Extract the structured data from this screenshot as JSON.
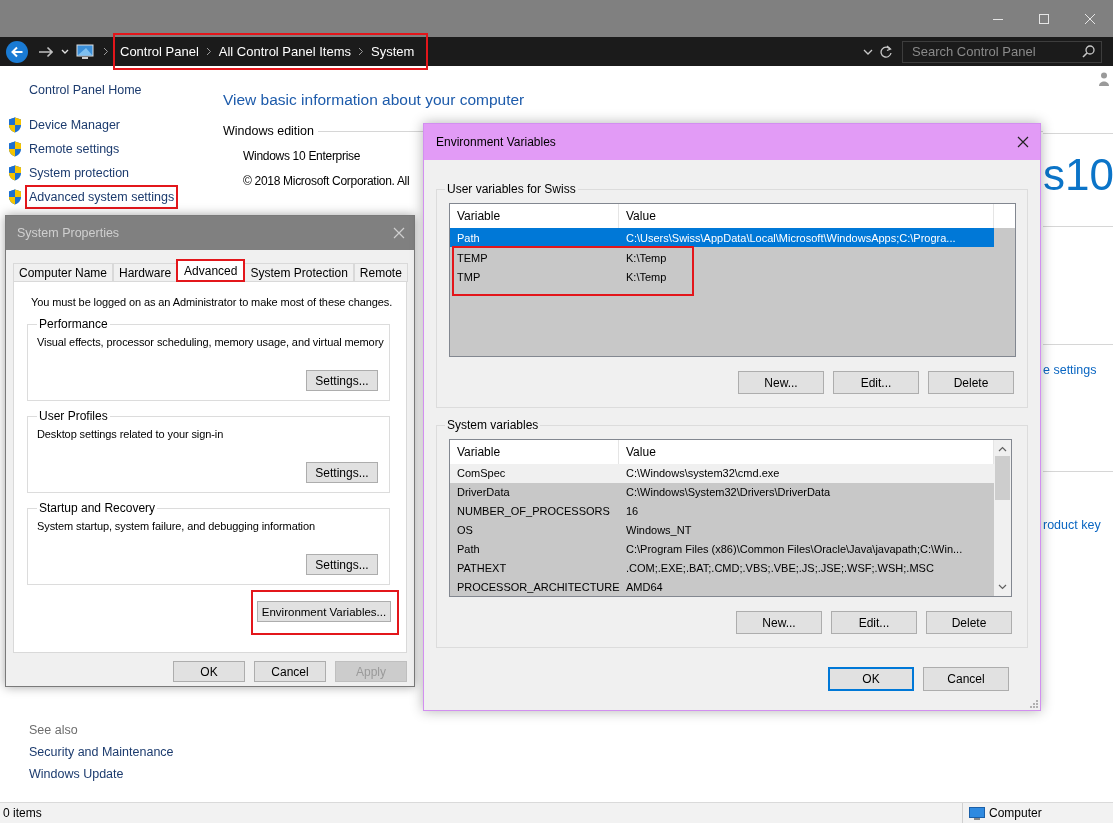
{
  "explorer": {
    "address_bar": {
      "breadcrumbs": [
        "Control Panel",
        "All Control Panel Items",
        "System"
      ],
      "highlighted": true
    },
    "search": {
      "placeholder": "Search Control Panel"
    },
    "sidebar": {
      "home": "Control Panel Home",
      "items": [
        {
          "label": "Device Manager",
          "highlighted": false
        },
        {
          "label": "Remote settings",
          "highlighted": false
        },
        {
          "label": "System protection",
          "highlighted": false
        },
        {
          "label": "Advanced system settings",
          "highlighted": true
        }
      ],
      "see_also": "See also",
      "links": [
        "Security and Maintenance",
        "Windows Update"
      ]
    },
    "main": {
      "heading": "View basic information about your computer",
      "section": "Windows edition",
      "lines": [
        "Windows 10 Enterprise",
        "© 2018 Microsoft Corporation. All"
      ],
      "logo_text": "s10",
      "links": [
        "e settings",
        "roduct key"
      ]
    },
    "status_bar": {
      "items": "0 items",
      "location": "Computer"
    }
  },
  "system_properties": {
    "title": "System Properties",
    "tabs": [
      {
        "label": "Computer Name",
        "selected": false,
        "highlighted": false
      },
      {
        "label": "Hardware",
        "selected": false,
        "highlighted": false
      },
      {
        "label": "Advanced",
        "selected": true,
        "highlighted": true
      },
      {
        "label": "System Protection",
        "selected": false,
        "highlighted": false
      },
      {
        "label": "Remote",
        "selected": false,
        "highlighted": false
      }
    ],
    "notice": "You must be logged on as an Administrator to make most of these changes.",
    "groups": [
      {
        "title": "Performance",
        "description": "Visual effects, processor scheduling, memory usage, and virtual memory",
        "button": "Settings..."
      },
      {
        "title": "User Profiles",
        "description": "Desktop settings related to your sign-in",
        "button": "Settings..."
      },
      {
        "title": "Startup and Recovery",
        "description": "System startup, system failure, and debugging information",
        "button": "Settings..."
      }
    ],
    "env_button": {
      "label": "Environment Variables...",
      "highlighted": true
    },
    "buttons": [
      {
        "label": "OK",
        "disabled": false
      },
      {
        "label": "Cancel",
        "disabled": false
      },
      {
        "label": "Apply",
        "disabled": true
      }
    ]
  },
  "environment_variables": {
    "title": "Environment Variables",
    "user": {
      "title": "User variables for Swiss",
      "columns": [
        "Variable",
        "Value"
      ],
      "focused": true,
      "rows": [
        {
          "variable": "Path",
          "value": "C:\\Users\\Swiss\\AppData\\Local\\Microsoft\\WindowsApps;C:\\Progra...",
          "selected": true,
          "highlighted": false
        },
        {
          "variable": "TEMP",
          "value": "K:\\Temp",
          "selected": false,
          "highlighted": true
        },
        {
          "variable": "TMP",
          "value": "K:\\Temp",
          "selected": false,
          "highlighted": true
        }
      ],
      "buttons": [
        "New...",
        "Edit...",
        "Delete"
      ]
    },
    "system": {
      "title": "System variables",
      "columns": [
        "Variable",
        "Value"
      ],
      "focused": false,
      "rows": [
        {
          "variable": "ComSpec",
          "value": "C:\\Windows\\system32\\cmd.exe",
          "selected": true,
          "highlighted": false
        },
        {
          "variable": "DriverData",
          "value": "C:\\Windows\\System32\\Drivers\\DriverData",
          "selected": false,
          "highlighted": false
        },
        {
          "variable": "NUMBER_OF_PROCESSORS",
          "value": "16",
          "selected": false,
          "highlighted": false
        },
        {
          "variable": "OS",
          "value": "Windows_NT",
          "selected": false,
          "highlighted": false
        },
        {
          "variable": "Path",
          "value": "C:\\Program Files (x86)\\Common Files\\Oracle\\Java\\javapath;C:\\Win...",
          "selected": false,
          "highlighted": false
        },
        {
          "variable": "PATHEXT",
          "value": ".COM;.EXE;.BAT;.CMD;.VBS;.VBE;.JS;.JSE;.WSF;.WSH;.MSC",
          "selected": false,
          "highlighted": false
        },
        {
          "variable": "PROCESSOR_ARCHITECTURE",
          "value": "AMD64",
          "selected": false,
          "highlighted": false
        }
      ],
      "buttons": [
        "New...",
        "Edit...",
        "Delete"
      ]
    },
    "buttons": [
      {
        "label": "OK",
        "default": true
      },
      {
        "label": "Cancel",
        "default": false
      }
    ]
  }
}
